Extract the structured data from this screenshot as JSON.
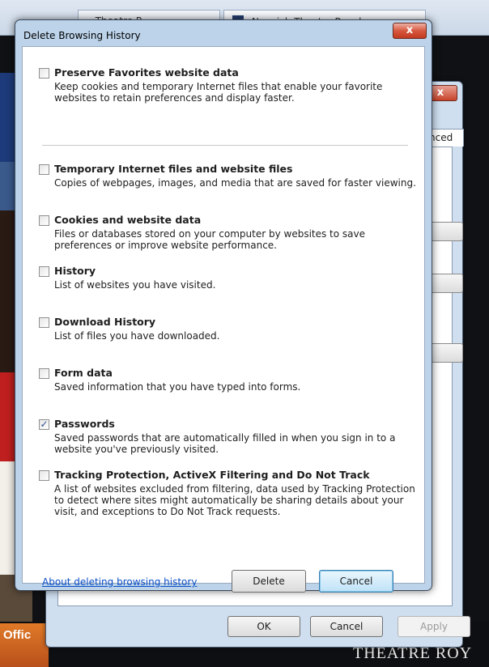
{
  "background": {
    "tabs": [
      {
        "label": "Theatre R"
      },
      {
        "label": "Norwich Theatre Royal"
      }
    ],
    "ad_text": "Offic",
    "bottom_text": "THEATRE ROY"
  },
  "options_window": {
    "tab_label": "nced",
    "buttons": {
      "ok": "OK",
      "cancel": "Cancel",
      "apply": "Apply"
    },
    "close_glyph": "x"
  },
  "dialog": {
    "title": "Delete Browsing History",
    "close_glyph": "x",
    "options": [
      {
        "label": "Preserve Favorites website data",
        "desc": "Keep cookies and temporary Internet files that enable your favorite websites to retain preferences and display faster.",
        "checked": false
      },
      {
        "label": "Temporary Internet files and website files",
        "desc": "Copies of webpages, images, and media that are saved for faster viewing.",
        "checked": false
      },
      {
        "label": "Cookies and website data",
        "desc": "Files or databases stored on your computer by websites to save preferences or improve website performance.",
        "checked": false
      },
      {
        "label": "History",
        "desc": "List of websites you have visited.",
        "checked": false
      },
      {
        "label": "Download History",
        "desc": "List of files you have downloaded.",
        "checked": false
      },
      {
        "label": "Form data",
        "desc": "Saved information that you have typed into forms.",
        "checked": false
      },
      {
        "label": "Passwords",
        "desc": "Saved passwords that are automatically filled in when you sign in to a website you've previously visited.",
        "checked": true
      },
      {
        "label": "Tracking Protection, ActiveX Filtering and Do Not Track",
        "desc": "A list of websites excluded from filtering, data used by Tracking Protection to detect where sites might automatically be sharing details about your visit, and exceptions to Do Not Track requests.",
        "checked": false
      }
    ],
    "about_link": "About deleting browsing history",
    "delete_label": "Delete",
    "cancel_label": "Cancel",
    "check_glyph": "✓"
  }
}
